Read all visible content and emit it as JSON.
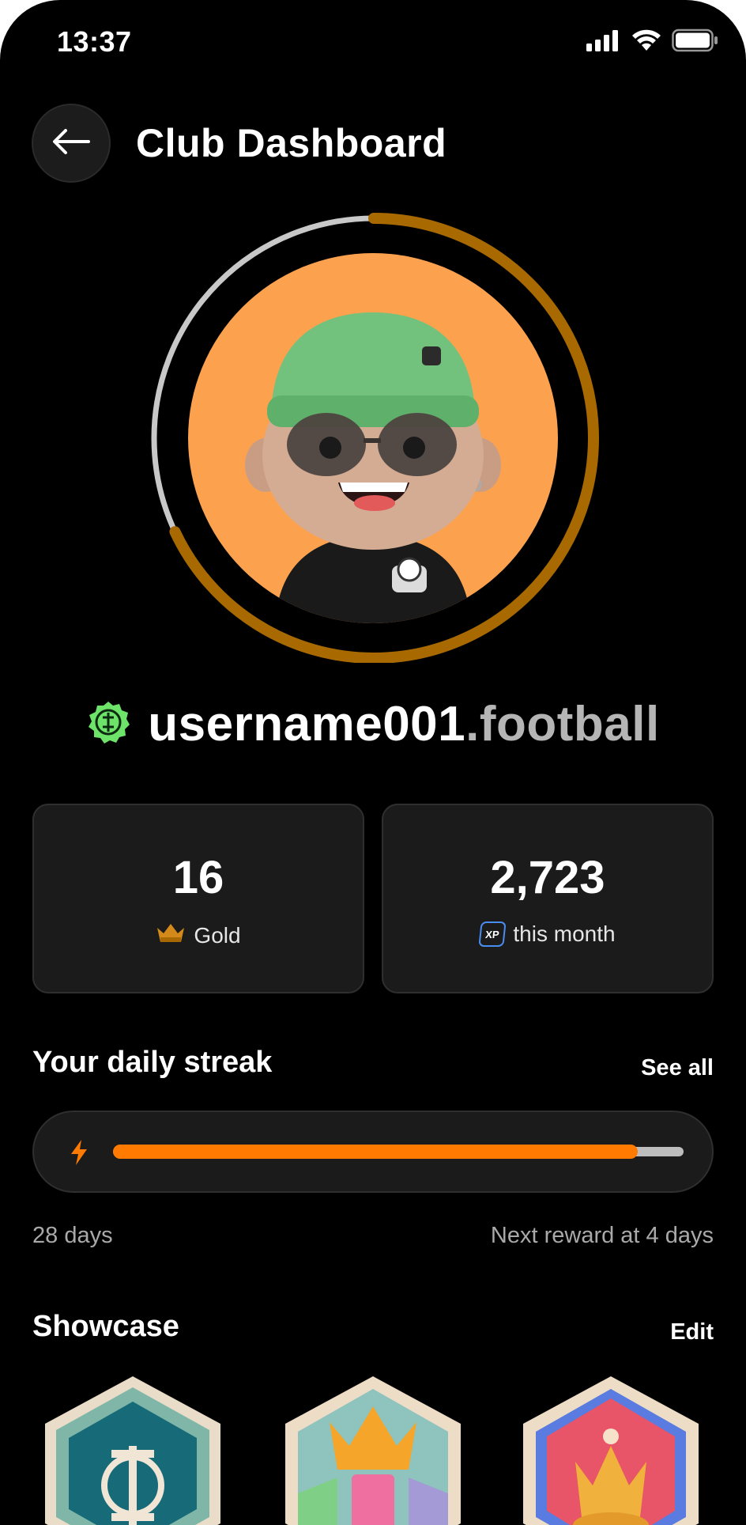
{
  "status_bar": {
    "time": "13:37",
    "icons": [
      "signal-icon",
      "wifi-icon",
      "battery-icon"
    ]
  },
  "header": {
    "title": "Club Dashboard",
    "back_icon": "arrow-left-icon"
  },
  "profile": {
    "level_progress": 0.32,
    "ring_colors": {
      "progress": "#a86a00",
      "track": "#c8c8c8"
    },
    "avatar_bg": "#fca24f",
    "verified_icon": "club-crest-badge-icon",
    "username": "username001",
    "domain": ".football"
  },
  "stats": [
    {
      "value": "16",
      "label": "Gold",
      "icon": "crown-icon"
    },
    {
      "value": "2,723",
      "label": "this month",
      "icon": "xp-icon",
      "icon_text": "XP"
    }
  ],
  "streak": {
    "title": "Your daily streak",
    "see_all": "See all",
    "progress": 0.92,
    "days": "28 days",
    "next_reward": "Next reward at 4 days",
    "accent": "#ff7a00"
  },
  "showcase": {
    "title": "Showcase",
    "edit": "Edit",
    "badges": [
      "club-crest-hexagon-badge",
      "crown-tower-hexagon-badge",
      "crown-red-hexagon-badge"
    ]
  }
}
